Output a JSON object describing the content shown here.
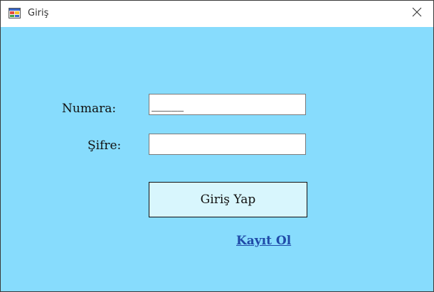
{
  "window": {
    "title": "Giriş",
    "icon": "winforms-app-icon",
    "close_icon": "close-icon"
  },
  "form": {
    "number_label": "Numara:",
    "number_value": "_____",
    "password_label": "Şifre:",
    "password_value": "",
    "login_button_label": "Giriş Yap",
    "register_link_label": "Kayıt Ol"
  },
  "colors": {
    "background": "#87dcfd",
    "button_background": "#d8f6fd",
    "link": "#1f4aa8"
  }
}
